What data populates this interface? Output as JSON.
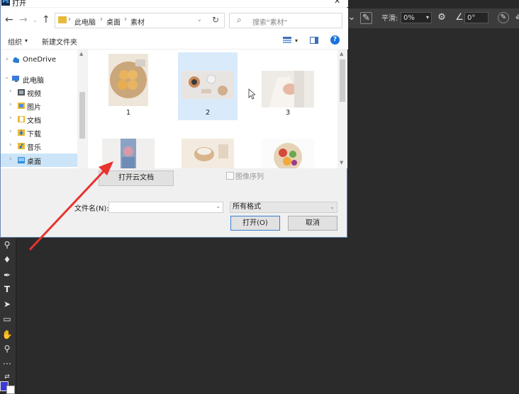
{
  "dialog": {
    "title": "打开",
    "close": "✕",
    "app_icon": "Ps"
  },
  "nav": {
    "breadcrumb": [
      "此电脑",
      "桌面",
      "素材"
    ],
    "separator": "›",
    "search_placeholder": "搜索\"素材\""
  },
  "commands": {
    "organize": "组织",
    "organize_chevron": "▾",
    "new_folder": "新建文件夹",
    "help": "?"
  },
  "sidebar": {
    "items": [
      {
        "label": "OneDrive",
        "icon": "cloud-icon",
        "color": "#2b7cd3"
      },
      {
        "label": "此电脑",
        "icon": "computer-icon",
        "color": "#3a7bd5"
      },
      {
        "label": "视频",
        "icon": "video-folder-icon",
        "color": "#6a6a6a"
      },
      {
        "label": "图片",
        "icon": "pictures-folder-icon",
        "color": "#e8b93a"
      },
      {
        "label": "文档",
        "icon": "documents-folder-icon",
        "color": "#e8b93a"
      },
      {
        "label": "下载",
        "icon": "downloads-folder-icon",
        "color": "#e8b93a"
      },
      {
        "label": "音乐",
        "icon": "music-folder-icon",
        "color": "#e8b93a"
      },
      {
        "label": "桌面",
        "icon": "desktop-folder-icon",
        "color": "#2b8fe0"
      }
    ],
    "selected": "桌面"
  },
  "files": [
    {
      "label": "1",
      "selected": false
    },
    {
      "label": "2",
      "selected": true
    },
    {
      "label": "3",
      "selected": false
    },
    {
      "label": "",
      "selected": false
    },
    {
      "label": "",
      "selected": false
    },
    {
      "label": "",
      "selected": false
    }
  ],
  "bottom": {
    "cloud_button": "打开云文档",
    "image_sequence": "图像序列",
    "filename_label": "文件名(N):",
    "filename_value": "",
    "filter_value": "所有格式",
    "open_button": "打开(O)",
    "cancel_button": "取消"
  },
  "ps": {
    "smoothing_label": "平滑:",
    "smoothing_value": "0%",
    "angle_value": "0°"
  },
  "colors": {
    "accent": "#1a73d9",
    "selection": "#cce4f7",
    "arrow": "#e8322c"
  }
}
